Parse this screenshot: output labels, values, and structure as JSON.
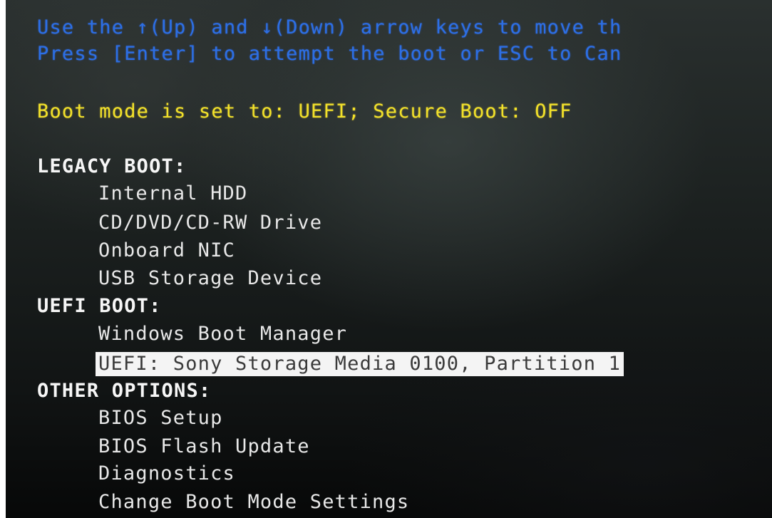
{
  "instructions": {
    "line1": "Use the ↑(Up) and ↓(Down) arrow keys to move th",
    "line2": "Press [Enter] to attempt the boot or ESC to Can"
  },
  "status": "Boot mode is set to: UEFI; Secure Boot: OFF",
  "sections": {
    "legacy": {
      "header": "LEGACY BOOT:",
      "items": [
        "Internal HDD",
        "CD/DVD/CD-RW Drive",
        "Onboard NIC",
        "USB Storage Device"
      ]
    },
    "uefi": {
      "header": "UEFI BOOT:",
      "items": [
        "Windows Boot Manager",
        "UEFI: Sony Storage Media 0100, Partition 1"
      ]
    },
    "other": {
      "header": "OTHER OPTIONS:",
      "items": [
        "BIOS Setup",
        "BIOS Flash Update",
        "Diagnostics",
        "Change Boot Mode Settings"
      ]
    }
  },
  "selected_item": "UEFI: Sony Storage Media 0100, Partition 1",
  "colors": {
    "instruction_text": "#2c6fe6",
    "status_text": "#f2e12a",
    "menu_text": "#e8e8e8",
    "selection_background": "#f4f4f4"
  }
}
